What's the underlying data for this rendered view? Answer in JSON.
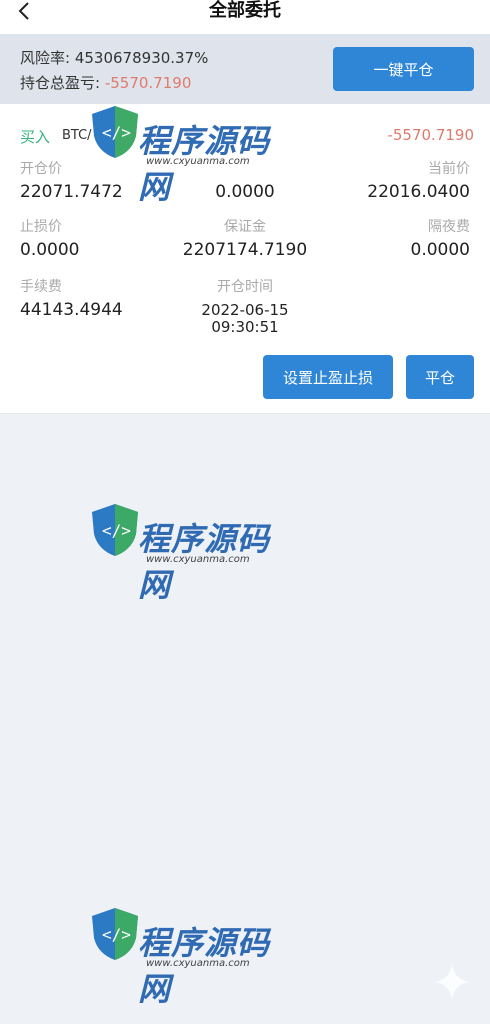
{
  "header": {
    "title": "全部委托",
    "back_icon": "chevron-left-icon"
  },
  "summary": {
    "risk_label": "风险率:",
    "risk_value": "4530678930.37%",
    "total_pnl_label": "持仓总盈亏:",
    "total_pnl_value": "-5570.7190",
    "close_all_label": "一键平仓"
  },
  "position": {
    "side": "买入",
    "symbol": "BTC/",
    "pnl": "-5570.7190",
    "fields": {
      "open_price_label": "开仓价",
      "open_price_value": "22071.7472",
      "middle_value": "0.0000",
      "current_price_label": "当前价",
      "current_price_value": "22016.0400",
      "stop_loss_label": "止损价",
      "stop_loss_value": "0.0000",
      "margin_label": "保证金",
      "margin_value": "2207174.7190",
      "overnight_fee_label": "隔夜费",
      "overnight_fee_value": "0.0000",
      "fee_label": "手续费",
      "fee_value": "44143.4944",
      "open_time_label": "开仓时间",
      "open_time_date": "2022-06-15",
      "open_time_clock": "09:30:51"
    },
    "set_tp_sl_label": "设置止盈止损",
    "close_label": "平仓"
  },
  "watermark": {
    "text": "程序源码网",
    "url": "www.cxyuanma.com"
  },
  "colors": {
    "primary_button": "#2f86d6",
    "negative": "#e07a6a",
    "buy": "#35b37e",
    "background": "#eef2f7"
  }
}
